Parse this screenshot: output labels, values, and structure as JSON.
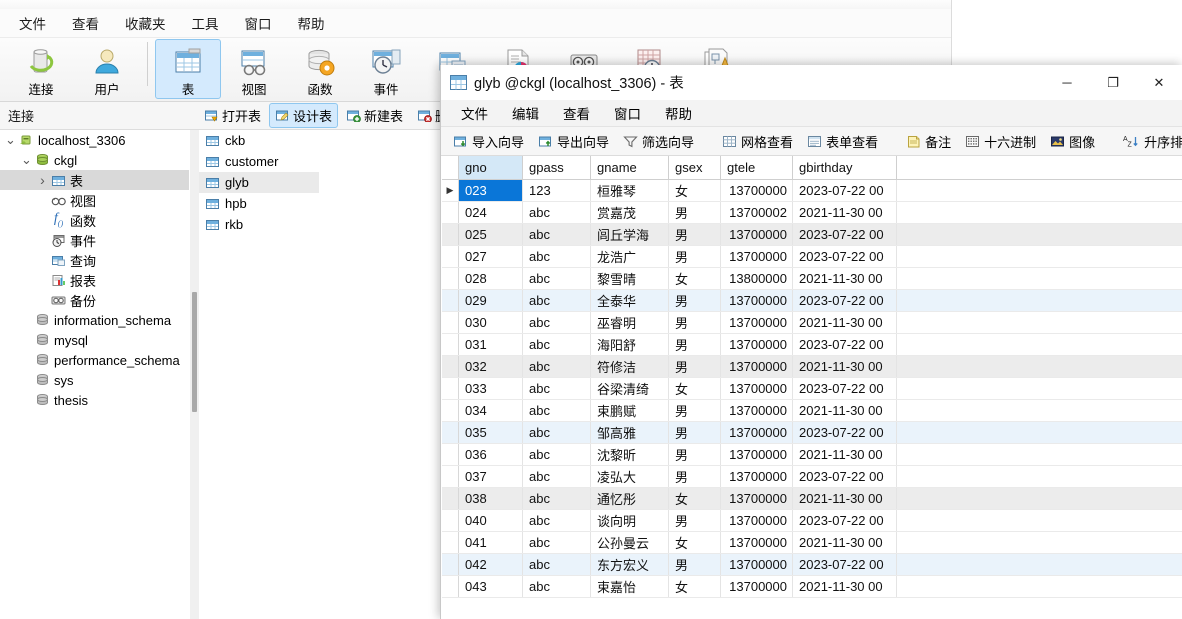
{
  "main_window": {
    "menubar": [
      {
        "label": "文件"
      },
      {
        "label": "查看"
      },
      {
        "label": "收藏夹"
      },
      {
        "label": "工具"
      },
      {
        "label": "窗口"
      },
      {
        "label": "帮助"
      }
    ],
    "toolbar": [
      {
        "label": "连接",
        "icon": "connection-icon",
        "selected": false
      },
      {
        "label": "用户",
        "icon": "user-icon",
        "selected": false
      },
      {
        "label": "表",
        "icon": "table-icon",
        "selected": true
      },
      {
        "label": "视图",
        "icon": "view-icon",
        "selected": false
      },
      {
        "label": "函数",
        "icon": "function-icon",
        "selected": false
      },
      {
        "label": "事件",
        "icon": "event-icon",
        "selected": false
      },
      {
        "label": "",
        "icon": "query-icon",
        "selected": false
      },
      {
        "label": "",
        "icon": "report-icon",
        "selected": false
      },
      {
        "label": "",
        "icon": "backup-icon",
        "selected": false
      },
      {
        "label": "",
        "icon": "schedule-icon",
        "selected": false
      },
      {
        "label": "",
        "icon": "model-icon",
        "selected": false
      }
    ],
    "subbar": {
      "title": "连接",
      "buttons": [
        {
          "label": "打开表",
          "icon": "open-table-icon",
          "selected": false
        },
        {
          "label": "设计表",
          "icon": "design-table-icon",
          "selected": true
        },
        {
          "label": "新建表",
          "icon": "new-table-icon",
          "selected": false
        },
        {
          "label": "删除",
          "icon": "delete-table-icon",
          "selected": false
        }
      ]
    },
    "tree": [
      {
        "label": "localhost_3306",
        "indent": 0,
        "twisty": "v",
        "icon": "server-icon",
        "selected": false
      },
      {
        "label": "ckgl",
        "indent": 1,
        "twisty": "v",
        "icon": "database-icon",
        "selected": false
      },
      {
        "label": "表",
        "indent": 2,
        "twisty": ">",
        "icon": "table-icon",
        "selected": true
      },
      {
        "label": "视图",
        "indent": 2,
        "twisty": "",
        "icon": "view-icon",
        "selected": false
      },
      {
        "label": "函数",
        "indent": 2,
        "twisty": "",
        "icon": "function-icon",
        "selected": false
      },
      {
        "label": "事件",
        "indent": 2,
        "twisty": "",
        "icon": "event-icon",
        "selected": false
      },
      {
        "label": "查询",
        "indent": 2,
        "twisty": "",
        "icon": "query-icon",
        "selected": false
      },
      {
        "label": "报表",
        "indent": 2,
        "twisty": "",
        "icon": "report-icon",
        "selected": false
      },
      {
        "label": "备份",
        "indent": 2,
        "twisty": "",
        "icon": "backup-icon",
        "selected": false
      },
      {
        "label": "information_schema",
        "indent": 1,
        "twisty": "",
        "icon": "database-gray-icon",
        "selected": false
      },
      {
        "label": "mysql",
        "indent": 1,
        "twisty": "",
        "icon": "database-gray-icon",
        "selected": false
      },
      {
        "label": "performance_schema",
        "indent": 1,
        "twisty": "",
        "icon": "database-gray-icon",
        "selected": false
      },
      {
        "label": "sys",
        "indent": 1,
        "twisty": "",
        "icon": "database-gray-icon",
        "selected": false
      },
      {
        "label": "thesis",
        "indent": 1,
        "twisty": "",
        "icon": "database-gray-icon",
        "selected": false
      }
    ],
    "table_list": [
      {
        "label": "ckb",
        "selected": false
      },
      {
        "label": "customer",
        "selected": false
      },
      {
        "label": "glyb",
        "selected": true
      },
      {
        "label": "hpb",
        "selected": false
      },
      {
        "label": "rkb",
        "selected": false
      }
    ]
  },
  "child_window": {
    "title": "glyb @ckgl (localhost_3306) - 表",
    "title_icon": "table-icon",
    "controls": [
      {
        "name": "minimize",
        "glyph": "─"
      },
      {
        "name": "maximize",
        "glyph": "❐"
      },
      {
        "name": "close",
        "glyph": "✕"
      }
    ],
    "menubar": [
      {
        "label": "文件"
      },
      {
        "label": "编辑"
      },
      {
        "label": "查看"
      },
      {
        "label": "窗口"
      },
      {
        "label": "帮助"
      }
    ],
    "toolbar": [
      {
        "label": "导入向导",
        "icon": "import-wizard-icon"
      },
      {
        "label": "导出向导",
        "icon": "export-wizard-icon"
      },
      {
        "label": "筛选向导",
        "icon": "filter-wizard-icon"
      },
      {
        "sep": true
      },
      {
        "label": "网格查看",
        "icon": "grid-view-icon"
      },
      {
        "label": "表单查看",
        "icon": "form-view-icon"
      },
      {
        "sep": true
      },
      {
        "label": "备注",
        "icon": "memo-icon"
      },
      {
        "label": "十六进制",
        "icon": "hex-icon"
      },
      {
        "label": "图像",
        "icon": "image-icon"
      },
      {
        "sep": true
      },
      {
        "label": "升序排序",
        "icon": "sort-asc-icon"
      }
    ],
    "grid": {
      "columns": [
        "gno",
        "gpass",
        "gname",
        "gsex",
        "gtele",
        "gbirthday"
      ],
      "selected_row": 0,
      "selected_column": "gno",
      "rows": [
        {
          "gno": "023",
          "gpass": "123",
          "gname": "桓雅琴",
          "gsex": "女",
          "gtele": "13700000",
          "gbirthday": "2023-07-22 00",
          "stripe": "none"
        },
        {
          "gno": "024",
          "gpass": "abc",
          "gname": "赏嘉茂",
          "gsex": "男",
          "gtele": "13700002",
          "gbirthday": "2021-11-30 00",
          "stripe": "none"
        },
        {
          "gno": "025",
          "gpass": "abc",
          "gname": "闾丘学海",
          "gsex": "男",
          "gtele": "13700000",
          "gbirthday": "2023-07-22 00",
          "stripe": "gray"
        },
        {
          "gno": "027",
          "gpass": "abc",
          "gname": "龙浩广",
          "gsex": "男",
          "gtele": "13700000",
          "gbirthday": "2023-07-22 00",
          "stripe": "none"
        },
        {
          "gno": "028",
          "gpass": "abc",
          "gname": "黎雪晴",
          "gsex": "女",
          "gtele": "13800000",
          "gbirthday": "2021-11-30 00",
          "stripe": "none"
        },
        {
          "gno": "029",
          "gpass": "abc",
          "gname": "全泰华",
          "gsex": "男",
          "gtele": "13700000",
          "gbirthday": "2023-07-22 00",
          "stripe": "blue"
        },
        {
          "gno": "030",
          "gpass": "abc",
          "gname": "巫睿明",
          "gsex": "男",
          "gtele": "13700000",
          "gbirthday": "2021-11-30 00",
          "stripe": "none"
        },
        {
          "gno": "031",
          "gpass": "abc",
          "gname": "海阳舒",
          "gsex": "男",
          "gtele": "13700000",
          "gbirthday": "2023-07-22 00",
          "stripe": "none"
        },
        {
          "gno": "032",
          "gpass": "abc",
          "gname": "符修洁",
          "gsex": "男",
          "gtele": "13700000",
          "gbirthday": "2021-11-30 00",
          "stripe": "gray"
        },
        {
          "gno": "033",
          "gpass": "abc",
          "gname": "谷梁清绮",
          "gsex": "女",
          "gtele": "13700000",
          "gbirthday": "2023-07-22 00",
          "stripe": "none"
        },
        {
          "gno": "034",
          "gpass": "abc",
          "gname": "束鹏赋",
          "gsex": "男",
          "gtele": "13700000",
          "gbirthday": "2021-11-30 00",
          "stripe": "none"
        },
        {
          "gno": "035",
          "gpass": "abc",
          "gname": "邹高雅",
          "gsex": "男",
          "gtele": "13700000",
          "gbirthday": "2023-07-22 00",
          "stripe": "blue"
        },
        {
          "gno": "036",
          "gpass": "abc",
          "gname": "沈黎昕",
          "gsex": "男",
          "gtele": "13700000",
          "gbirthday": "2021-11-30 00",
          "stripe": "none"
        },
        {
          "gno": "037",
          "gpass": "abc",
          "gname": "凌弘大",
          "gsex": "男",
          "gtele": "13700000",
          "gbirthday": "2023-07-22 00",
          "stripe": "none"
        },
        {
          "gno": "038",
          "gpass": "abc",
          "gname": "通忆彤",
          "gsex": "女",
          "gtele": "13700000",
          "gbirthday": "2021-11-30 00",
          "stripe": "gray"
        },
        {
          "gno": "040",
          "gpass": "abc",
          "gname": "谈向明",
          "gsex": "男",
          "gtele": "13700000",
          "gbirthday": "2023-07-22 00",
          "stripe": "none"
        },
        {
          "gno": "041",
          "gpass": "abc",
          "gname": "公孙曼云",
          "gsex": "女",
          "gtele": "13700000",
          "gbirthday": "2021-11-30 00",
          "stripe": "none"
        },
        {
          "gno": "042",
          "gpass": "abc",
          "gname": "东方宏义",
          "gsex": "男",
          "gtele": "13700000",
          "gbirthday": "2023-07-22 00",
          "stripe": "blue"
        },
        {
          "gno": "043",
          "gpass": "abc",
          "gname": "束嘉怡",
          "gsex": "女",
          "gtele": "13700000",
          "gbirthday": "2021-11-30 00",
          "stripe": "none"
        }
      ]
    }
  },
  "colors": {
    "selection_blue": "#0a76d8",
    "header_highlight": "#d4e8f7",
    "toolbar_selected": "#d4eafd",
    "stripe_gray": "#ececec",
    "stripe_blue": "#eaf3fb"
  }
}
